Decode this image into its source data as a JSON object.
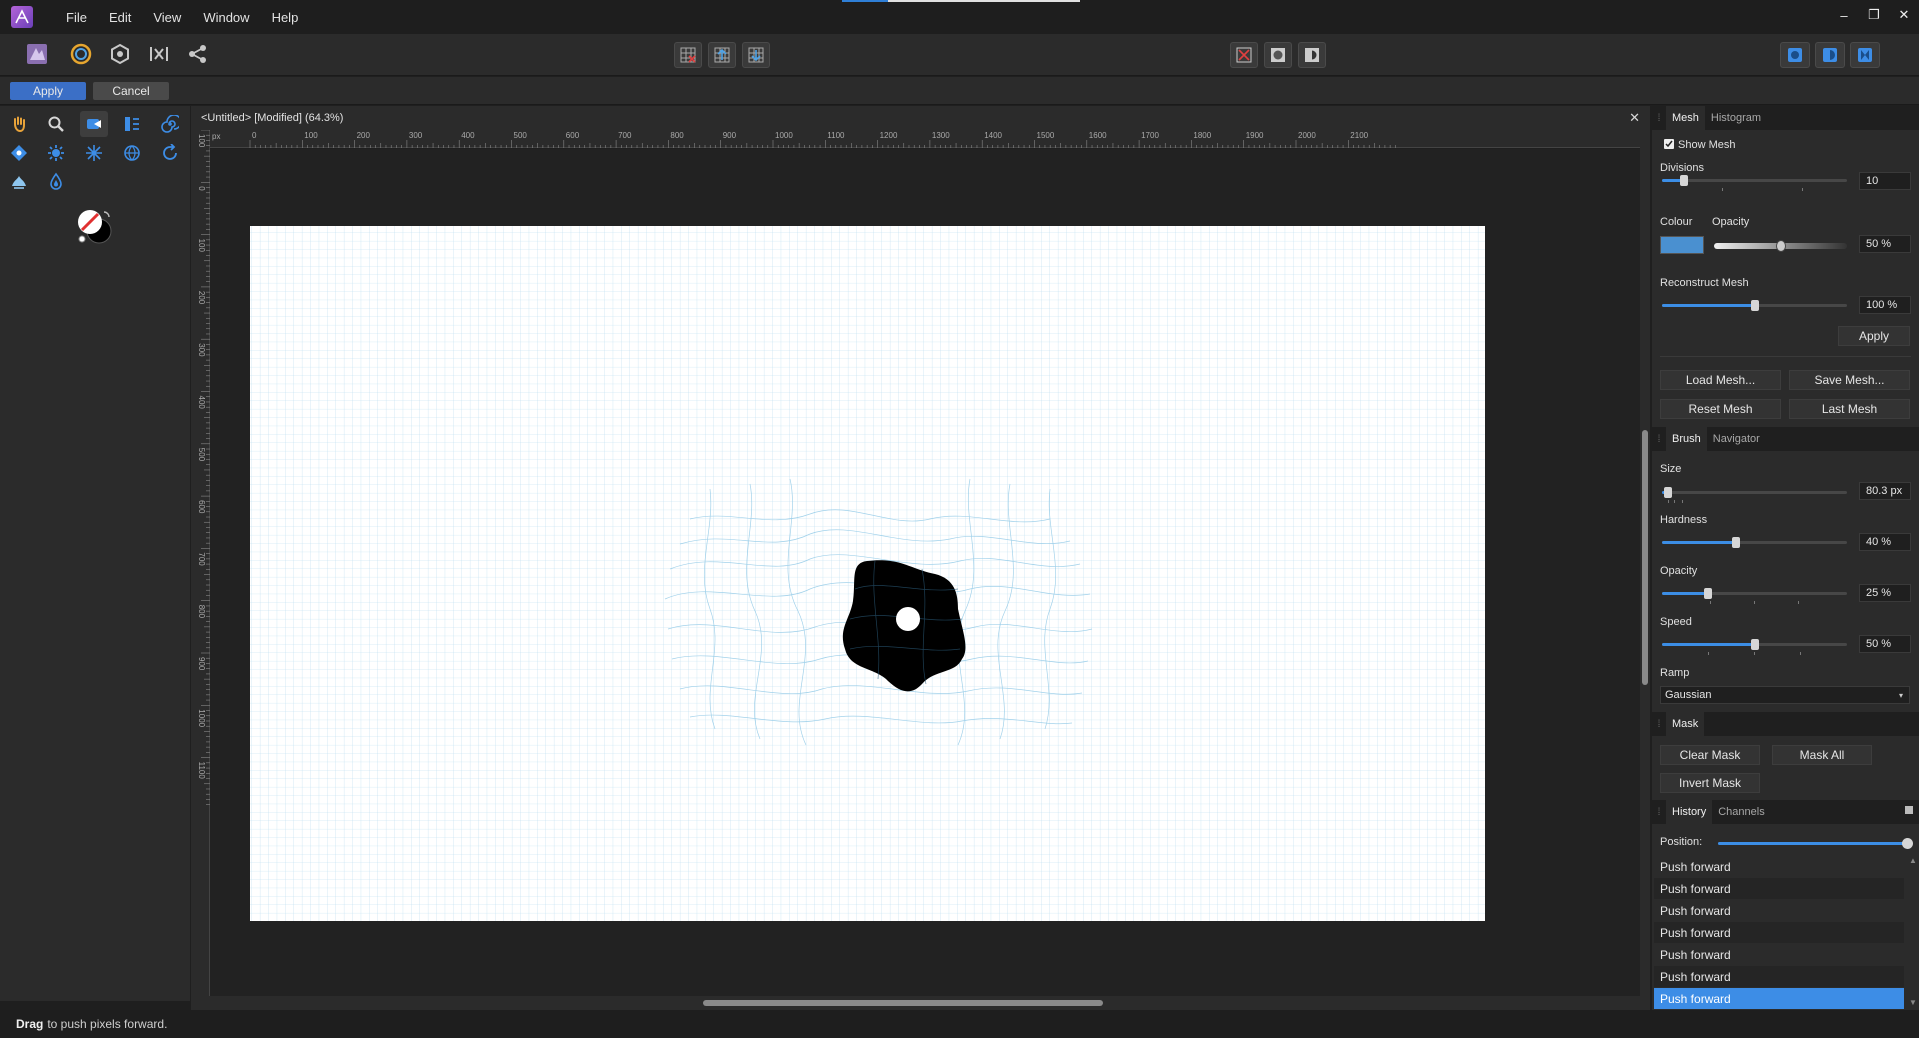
{
  "menubar": {
    "items": [
      "File",
      "Edit",
      "View",
      "Window",
      "Help"
    ],
    "minimize": "‒",
    "restore": "❐",
    "close": "✕"
  },
  "context": {
    "apply": "Apply",
    "cancel": "Cancel"
  },
  "document": {
    "title": "<Untitled> [Modified] (64.3%)",
    "close": "✕",
    "ruler_unit": "px",
    "ruler_top_labels": [
      "0",
      "100",
      "200",
      "300",
      "400",
      "500",
      "600",
      "700",
      "800",
      "900",
      "1000",
      "1100",
      "1200",
      "1300",
      "1400",
      "1500",
      "1600",
      "1700",
      "1800",
      "1900",
      "2000",
      "2100"
    ],
    "ruler_left_labels": [
      "100",
      "0",
      "100",
      "200",
      "300",
      "400",
      "500",
      "600",
      "700",
      "800",
      "900",
      "1000",
      "1100"
    ]
  },
  "mesh_panel": {
    "tabs": [
      "Mesh",
      "Histogram"
    ],
    "show_mesh": {
      "label": "Show Mesh",
      "checked": true
    },
    "divisions": {
      "label": "Divisions",
      "value": "10",
      "level": 0.12
    },
    "colour": {
      "label": "Colour",
      "swatch": "#4a90d0"
    },
    "opacity": {
      "label": "Opacity",
      "value": "50 %",
      "level": 0.5
    },
    "reconstruct": {
      "label": "Reconstruct Mesh",
      "value": "100 %",
      "level": 0.5
    },
    "apply": "Apply",
    "load": "Load Mesh...",
    "save": "Save Mesh...",
    "reset": "Reset Mesh",
    "last": "Last Mesh"
  },
  "brush_panel": {
    "tabs": [
      "Brush",
      "Navigator"
    ],
    "size": {
      "label": "Size",
      "value": "80.3 px",
      "level": 0.03
    },
    "hardness": {
      "label": "Hardness",
      "value": "40 %",
      "level": 0.4
    },
    "opacity": {
      "label": "Opacity",
      "value": "25 %",
      "level": 0.25
    },
    "speed": {
      "label": "Speed",
      "value": "50 %",
      "level": 0.5
    },
    "ramp": {
      "label": "Ramp",
      "value": "Gaussian"
    }
  },
  "mask_panel": {
    "tabs": [
      "Mask"
    ],
    "clear": "Clear Mask",
    "mask_all": "Mask All",
    "invert": "Invert Mask"
  },
  "history_panel": {
    "tabs": [
      "History",
      "Channels"
    ],
    "position_label": "Position:",
    "position": 1.0,
    "items": [
      "Push forward",
      "Push forward",
      "Push forward",
      "Push forward",
      "Push forward",
      "Push forward",
      "Push forward"
    ],
    "selected_index": 6
  },
  "status": {
    "key": "Drag",
    "text": "to push pixels forward."
  },
  "colors": {
    "accent": "#3d8de6",
    "apply_button": "#3b6fc6"
  }
}
